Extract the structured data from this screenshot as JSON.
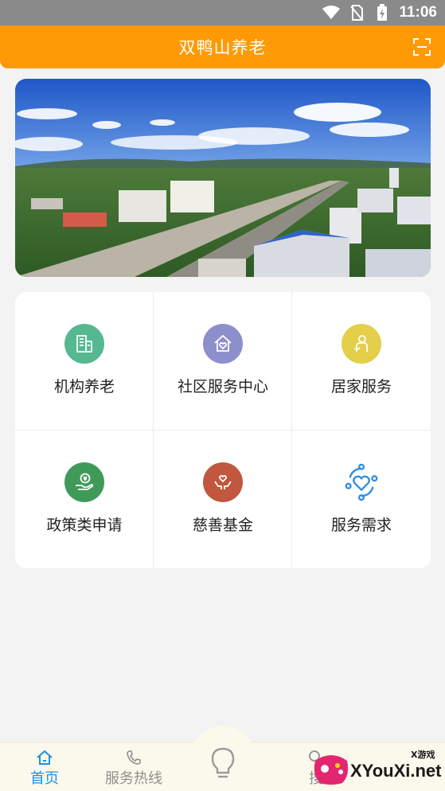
{
  "status_bar": {
    "time": "11:06",
    "icons": [
      "wifi-icon",
      "no-sim-icon",
      "battery-charging-icon"
    ]
  },
  "header": {
    "title": "双鸭山养老",
    "scan_icon": "scan-icon"
  },
  "banner": {
    "alt": "city-aerial-image"
  },
  "services": [
    {
      "label": "机构养老",
      "icon": "building-icon",
      "color": "#55b891"
    },
    {
      "label": "社区服务中心",
      "icon": "home-heart-icon",
      "color": "#8d8fcc"
    },
    {
      "label": "居家服务",
      "icon": "caregiver-icon",
      "color": "#e3cf4a"
    },
    {
      "label": "政策类申请",
      "icon": "hand-coin-icon",
      "color": "#3f9a5a"
    },
    {
      "label": "慈善基金",
      "icon": "charity-hands-icon",
      "color": "#c0573e"
    },
    {
      "label": "服务需求",
      "icon": "heart-people-icon",
      "color": "#2f8ce0"
    }
  ],
  "tabbar": {
    "items": [
      {
        "label": "首页",
        "icon": "home-icon",
        "active": true
      },
      {
        "label": "服务热线",
        "icon": "phone-icon",
        "active": false
      },
      {
        "label": "",
        "icon": "lightbulb-icon",
        "active": false
      },
      {
        "label": "搜",
        "icon": "search-icon",
        "active": false
      }
    ]
  },
  "watermark": {
    "text": "XYouXi.net",
    "small": "X游戏"
  },
  "colors": {
    "accent": "#fe9a06",
    "tab_active": "#1e90e6"
  }
}
